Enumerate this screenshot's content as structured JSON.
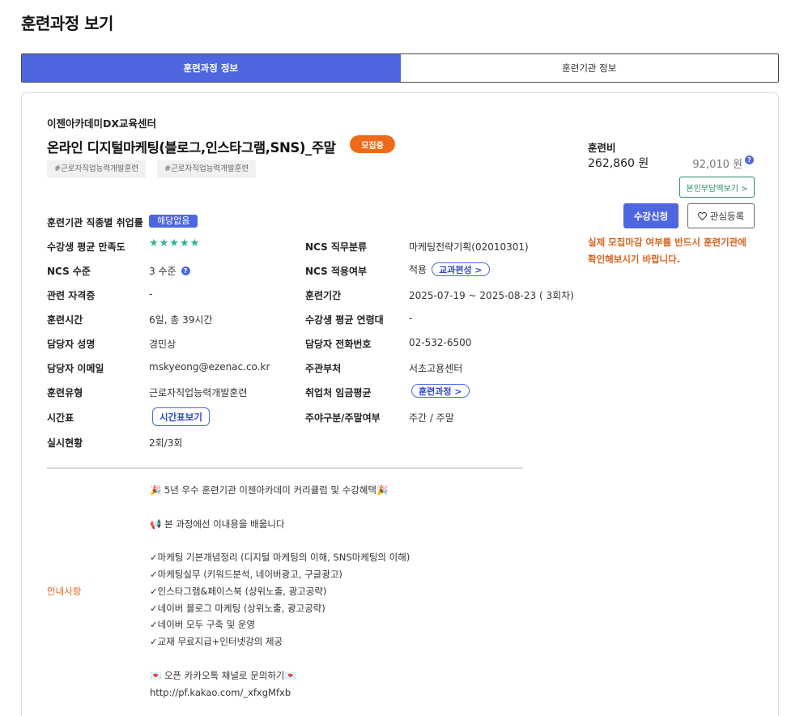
{
  "page": {
    "title": "훈련과정 보기"
  },
  "tabs": [
    {
      "label": "훈련과정 정보",
      "active": true
    },
    {
      "label": "훈련기관 정보",
      "active": false
    }
  ],
  "course": {
    "org": "이젠아카데미DX교육센터",
    "title": "온라인 디지털마케팅(블로그,인스타그램,SNS)_주말",
    "status": "모집중",
    "tags": [
      "#근로자직업능력개발훈련",
      "#근로자직업능력개발훈련"
    ]
  },
  "fee": {
    "label": "훈련비",
    "amount": "262,860 원",
    "self_pay": "92,010 원",
    "info_icon": "?",
    "self_pay_button": "본인부담액보기 >"
  },
  "actions": {
    "enroll": "수강신청",
    "favorite": "관심등록",
    "notice": "실제 모집마감 여부를 반드시 훈련기관에 확인해보시기 바랍니다."
  },
  "details": {
    "employment_rate": {
      "label": "훈련기관 직종별 취업률",
      "value": "해당없음"
    },
    "satisfaction": {
      "label": "수강생 평균 만족도",
      "stars": "★★★★★",
      "rating": 5
    },
    "ncs_category": {
      "label": "NCS 직무분류",
      "value": "마케팅전략기획(02010301)"
    },
    "ncs_level": {
      "label": "NCS 수준",
      "value": "3 수준"
    },
    "ncs_applied": {
      "label": "NCS 적용여부",
      "value": "적용",
      "button": "교과편성 >"
    },
    "certificate": {
      "label": "관련 자격증",
      "value": "-"
    },
    "period": {
      "label": "훈련기간",
      "value": "2025-07-19 ~ 2025-08-23 ( 3회차)"
    },
    "hours": {
      "label": "훈련시간",
      "value": "6일, 총 39시간"
    },
    "avg_age": {
      "label": "수강생 평균 연령대",
      "value": "-"
    },
    "manager": {
      "label": "담당자 성명",
      "value": "경민상"
    },
    "phone": {
      "label": "담당자 전화번호",
      "value": "02-532-6500"
    },
    "email": {
      "label": "담당자 이메일",
      "value": "mskyeong@ezenac.co.kr"
    },
    "dept": {
      "label": "주관부처",
      "value": "서초고용센터"
    },
    "type": {
      "label": "훈련유형",
      "value": "근로자직업능력개발훈련"
    },
    "wage": {
      "label": "취업처 임금평균",
      "button": "훈련과정 >"
    },
    "timetable": {
      "label": "시간표",
      "button": "시간표보기"
    },
    "daynight": {
      "label": "주야구분/주말여부",
      "value": "주간 / 주말"
    },
    "status": {
      "label": "실시현황",
      "value": "2회/3회"
    }
  },
  "guide": {
    "label": "안내사항",
    "text": "🎉 5년 우수 훈련기관 이젠아카데미 커리큘럼 및 수강혜택🎉\n\n📢 본 과정에선 이내용을 배웁니다\n\n✓마케팅 기본개념정리 (디지털 마케팅의 이해, SNS마케팅의 이해)\n✓마케팅실무 (키워드분석, 네이버광고, 구글광고)\n✓인스타그램&페이스북 (상위노출, 광고공략)\n✓네이버 블로그 마케팅 (상위노출, 광고공략)\n✓네이버 모두 구축 및 운영\n✓교재 무료지급+인터넷강의 제공\n\n💌 오픈 카카오톡 채널로 문의하기💌\nhttp://pf.kakao.com/_xfxgMfxb"
  }
}
